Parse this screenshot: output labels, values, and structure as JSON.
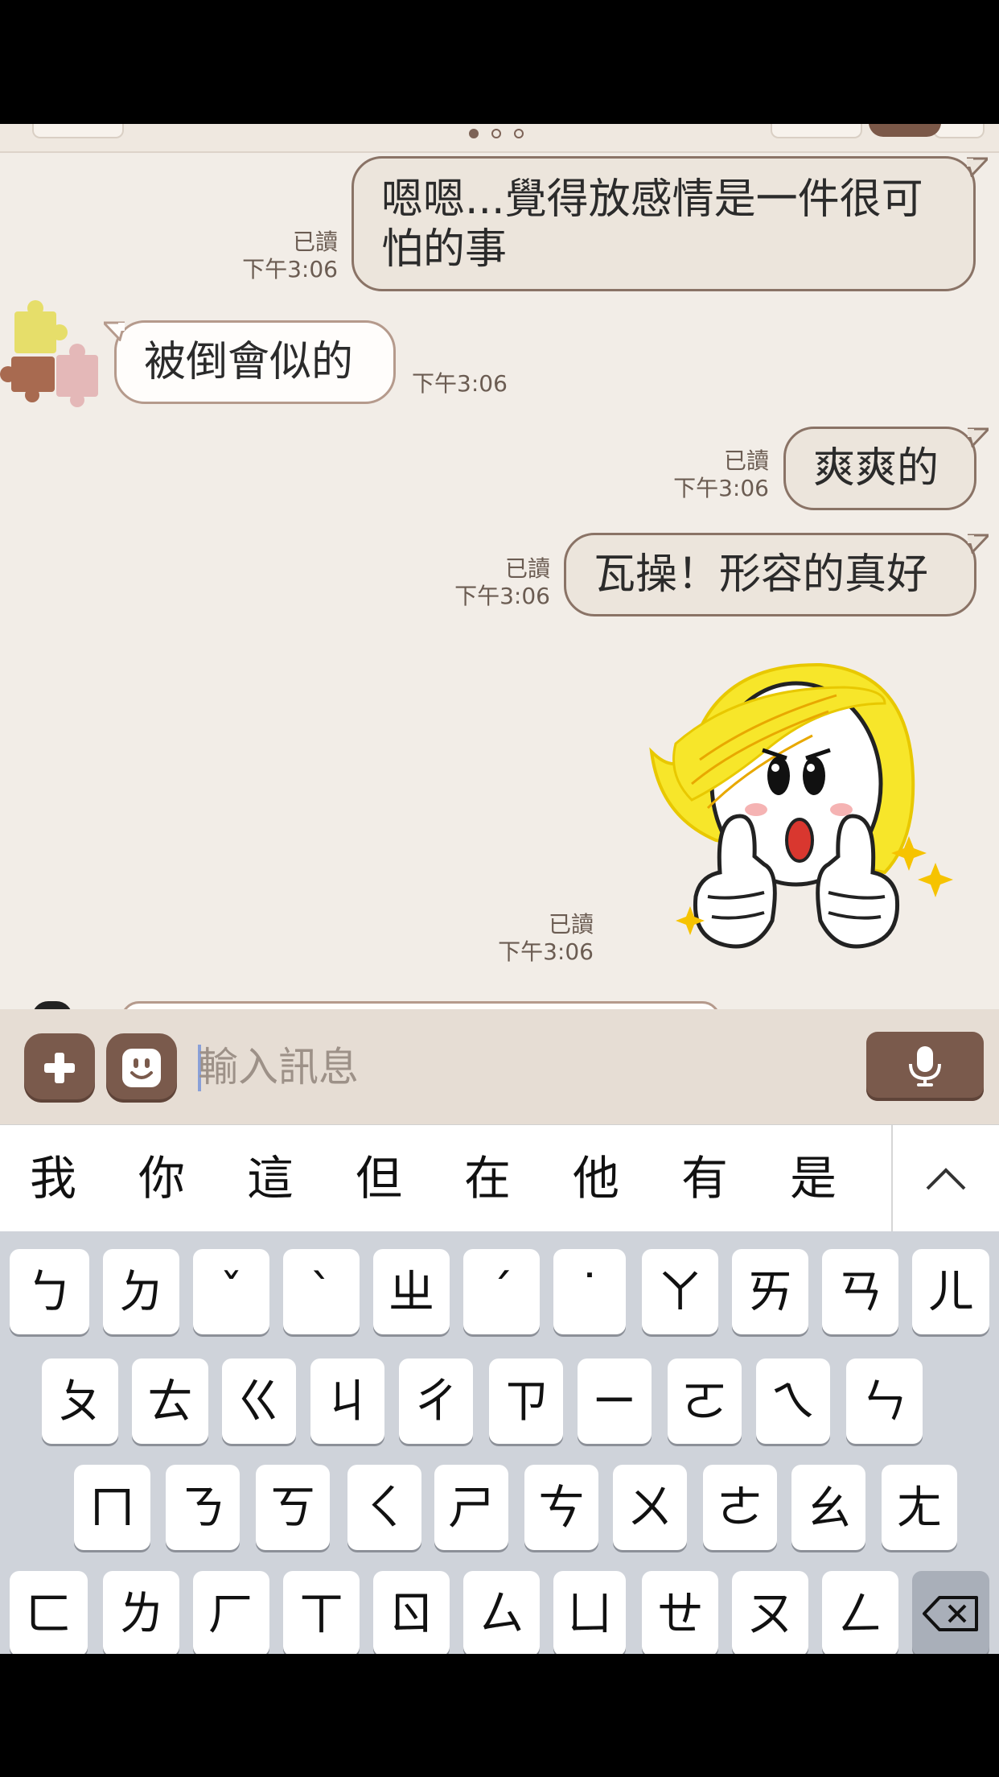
{
  "chat": {
    "messages": [
      {
        "direction": "out",
        "text_line1": "嗯嗯...覺得放感情是一件很可",
        "text_line2": "怕的事",
        "read": "已讀",
        "time": "下午3:06"
      },
      {
        "direction": "in",
        "text": "被倒會似的",
        "time": "下午3:06"
      },
      {
        "direction": "out",
        "text": "爽爽的",
        "read": "已讀",
        "time": "下午3:06"
      },
      {
        "direction": "out",
        "text": "瓦操！形容的真好",
        "read": "已讀",
        "time": "下午3:06"
      },
      {
        "direction": "out",
        "type": "sticker",
        "sticker": "thumbs-up-blonde-girl-sticker",
        "read": "已讀",
        "time": "下午3:06"
      }
    ]
  },
  "input": {
    "placeholder": "輸入訊息",
    "plus_icon": "plus-icon",
    "emoji_icon": "smiley-icon",
    "mic_icon": "microphone-icon"
  },
  "candidates": [
    "我",
    "你",
    "這",
    "但",
    "在",
    "他",
    "有",
    "是"
  ],
  "keyboard": {
    "row1": [
      "ㄅ",
      "ㄉ",
      "ˇ",
      "ˋ",
      "ㄓ",
      "ˊ",
      "˙",
      "ㄚ",
      "ㄞ",
      "ㄢ",
      "ㄦ"
    ],
    "row2": [
      "ㄆ",
      "ㄊ",
      "ㄍ",
      "ㄐ",
      "ㄔ",
      "ㄗ",
      "ㄧ",
      "ㄛ",
      "ㄟ",
      "ㄣ"
    ],
    "row3": [
      "ㄇ",
      "ㄋ",
      "ㄎ",
      "ㄑ",
      "ㄕ",
      "ㄘ",
      "ㄨ",
      "ㄜ",
      "ㄠ",
      "ㄤ"
    ],
    "row4": [
      "ㄈ",
      "ㄌ",
      "ㄏ",
      "ㄒ",
      "ㄖ",
      "ㄙ",
      "ㄩ",
      "ㄝ",
      "ㄡ",
      "ㄥ"
    ]
  },
  "colors": {
    "bubble_out": "#ece5dc",
    "bubble_border": "#8a7366",
    "accent": "#7a5a4c",
    "chat_bg": "#f2ede7"
  }
}
